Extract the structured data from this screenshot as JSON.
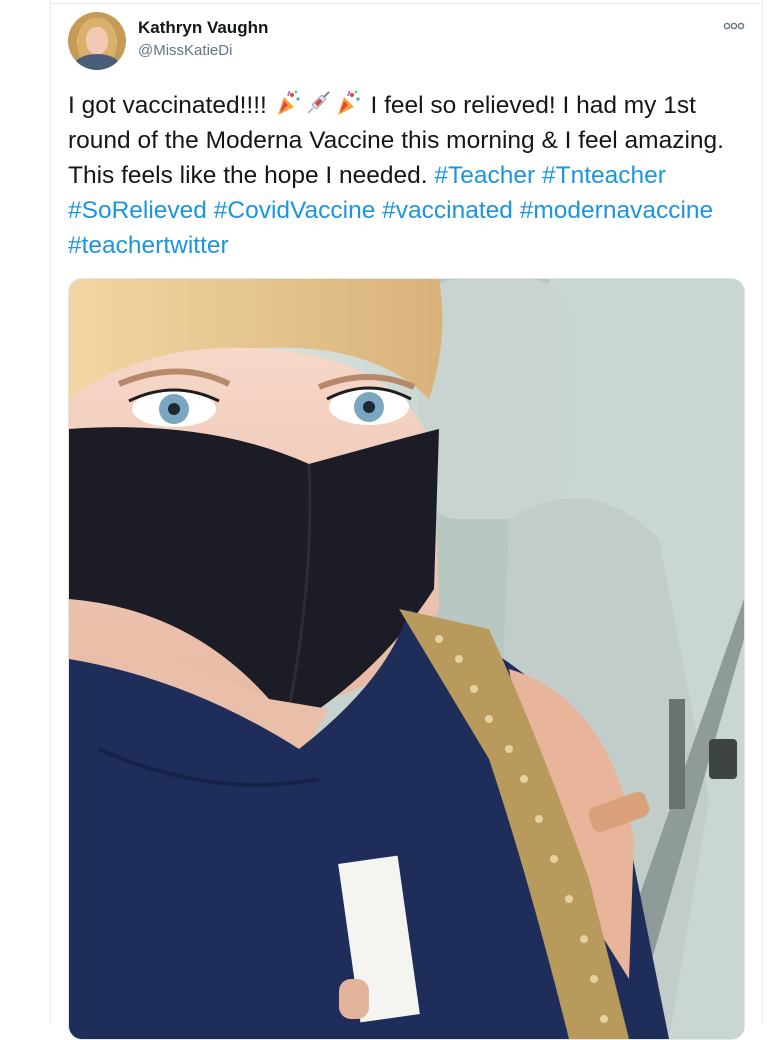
{
  "tweet": {
    "display_name": "Kathryn Vaughn",
    "handle": "@MissKatieDi",
    "more_icon": "more-icon",
    "text_parts": {
      "p1": "I got vaccinated!!!! ",
      "p2": " I feel so relieved! I had my 1st round of the Moderna Vaccine this morning & I feel amazing. This feels like the hope I needed. ",
      "h1": "#Teacher",
      "h2": "#Tnteacher",
      "h3": "#SoRelieved",
      "h4": "#CovidVaccine",
      "h5": "#vaccinated",
      "h6": "#modernavaccine",
      "h7": "#teachertwitter"
    },
    "emojis": [
      "party-popper-icon",
      "syringe-icon",
      "party-popper-icon"
    ]
  },
  "colors": {
    "text": "#14171a",
    "secondary": "#657786",
    "hashtag": "#1b95e0"
  }
}
